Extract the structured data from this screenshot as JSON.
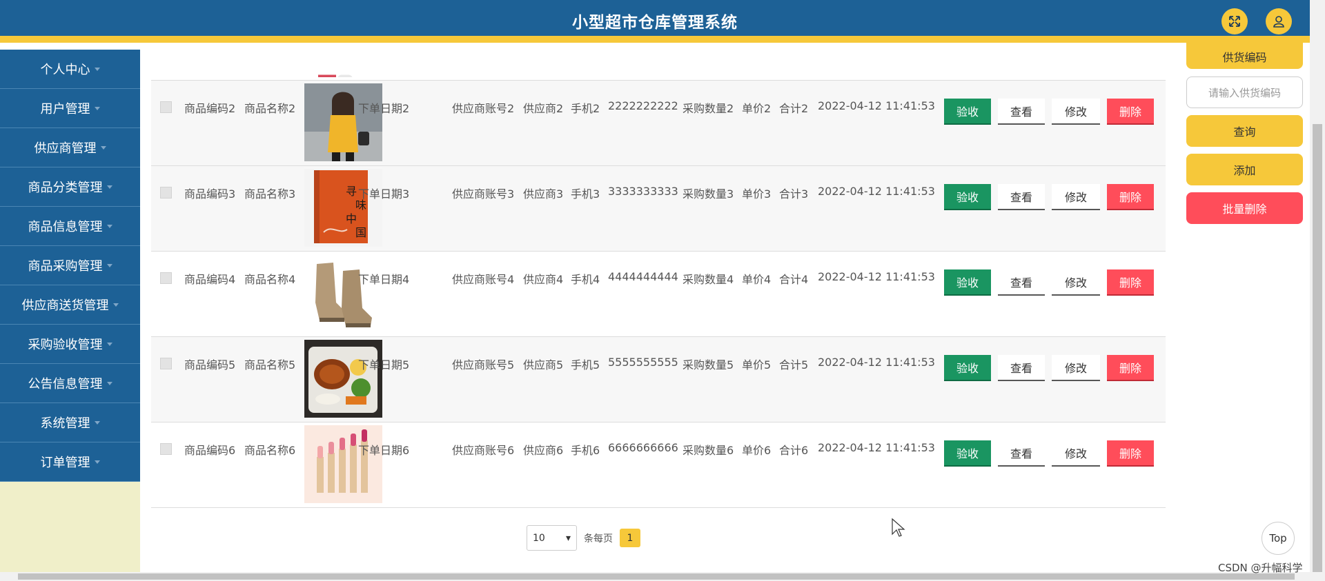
{
  "app": {
    "title": "小型超市仓库管理系统"
  },
  "header": {
    "fullscreen_icon": "expand-icon",
    "user_icon": "user-icon"
  },
  "sidebar": {
    "items": [
      {
        "label": "个人中心"
      },
      {
        "label": "用户管理"
      },
      {
        "label": "供应商管理"
      },
      {
        "label": "商品分类管理"
      },
      {
        "label": "商品信息管理"
      },
      {
        "label": "商品采购管理"
      },
      {
        "label": "供应商送货管理"
      },
      {
        "label": "采购验收管理"
      },
      {
        "label": "公告信息管理"
      },
      {
        "label": "系统管理"
      },
      {
        "label": "订单管理"
      }
    ]
  },
  "table": {
    "rows": [
      {
        "code": "商品编码2",
        "name": "商品名称2",
        "order_date": "下单日期2",
        "account": "供应商账号2",
        "supplier": "供应商2",
        "phone_label": "手机2",
        "phone": "2222222222",
        "qty": "采购数量2",
        "price": "单价2",
        "total": "合计2",
        "time": "2022-04-12 11:41:53"
      },
      {
        "code": "商品编码3",
        "name": "商品名称3",
        "order_date": "下单日期3",
        "account": "供应商账号3",
        "supplier": "供应商3",
        "phone_label": "手机3",
        "phone": "3333333333",
        "qty": "采购数量3",
        "price": "单价3",
        "total": "合计3",
        "time": "2022-04-12 11:41:53"
      },
      {
        "code": "商品编码4",
        "name": "商品名称4",
        "order_date": "下单日期4",
        "account": "供应商账号4",
        "supplier": "供应商4",
        "phone_label": "手机4",
        "phone": "4444444444",
        "qty": "采购数量4",
        "price": "单价4",
        "total": "合计4",
        "time": "2022-04-12 11:41:53"
      },
      {
        "code": "商品编码5",
        "name": "商品名称5",
        "order_date": "下单日期5",
        "account": "供应商账号5",
        "supplier": "供应商5",
        "phone_label": "手机5",
        "phone": "5555555555",
        "qty": "采购数量5",
        "price": "单价5",
        "total": "合计5",
        "time": "2022-04-12 11:41:53"
      },
      {
        "code": "商品编码6",
        "name": "商品名称6",
        "order_date": "下单日期6",
        "account": "供应商账号6",
        "supplier": "供应商6",
        "phone_label": "手机6",
        "phone": "6666666666",
        "qty": "采购数量6",
        "price": "单价6",
        "total": "合计6",
        "time": "2022-04-12 11:41:53"
      }
    ],
    "actions": {
      "accept": "验收",
      "view": "查看",
      "edit": "修改",
      "delete": "删除"
    }
  },
  "pager": {
    "page_size": "10",
    "per_page_label": "条每页",
    "current_page": "1"
  },
  "right_panel": {
    "partial_label": "供货编码",
    "search_placeholder": "请输入供货编码",
    "query": "查询",
    "add": "添加",
    "batch_delete": "批量删除"
  },
  "top_button": "Top",
  "watermark": "CSDN @升幅科学",
  "colors": {
    "primary": "#1d6196",
    "accent": "#f6c83a",
    "success": "#1a9561",
    "danger": "#ff4d5a"
  }
}
